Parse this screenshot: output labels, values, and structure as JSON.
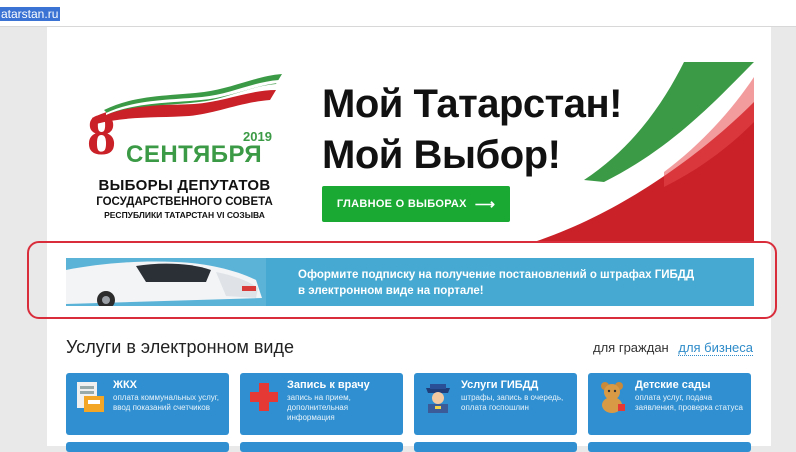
{
  "browser": {
    "url": "atarstan.ru"
  },
  "banner": {
    "date_number": "8",
    "year": "2019",
    "month": "СЕНТЯБРЯ",
    "elections_line1": "ВЫБОРЫ ДЕПУТАТОВ",
    "elections_line2": "ГОСУДАРСТВЕННОГО СОВЕТА",
    "elections_line3": "РЕСПУБЛИКИ ТАТАРСТАН VI СОЗЫВА",
    "headline_line1": "Мой Татарстан!",
    "headline_line2": "Мой Выбор!",
    "cta_label": "ГЛАВНОЕ О ВЫБОРАХ",
    "cta_arrow": "⟶",
    "colors": {
      "red": "#c92127",
      "green": "#3b9a45",
      "cta": "#1aaa33"
    }
  },
  "gibdd_banner": {
    "text_line1": "Оформите подписку на получение постановлений о штрафах ГИБДД",
    "text_line2": "в электронном виде на портале!"
  },
  "services": {
    "title": "Услуги в электронном виде",
    "tab_citizens": "для граждан",
    "tab_business": "для бизнеса",
    "tiles": [
      {
        "title": "ЖКХ",
        "desc": "оплата коммунальных услуг, ввод показаний счетчиков",
        "icon": "meter-icon"
      },
      {
        "title": "Запись к врачу",
        "desc": "запись на прием, дополнительная информация",
        "icon": "medical-cross-icon"
      },
      {
        "title": "Услуги ГИБДД",
        "desc": "штрафы, запись в очередь, оплата госпошлин",
        "icon": "police-officer-icon"
      },
      {
        "title": "Детские сады",
        "desc": "оплата услуг, подача заявления, проверка статуса",
        "icon": "teddy-bear-icon"
      }
    ]
  }
}
